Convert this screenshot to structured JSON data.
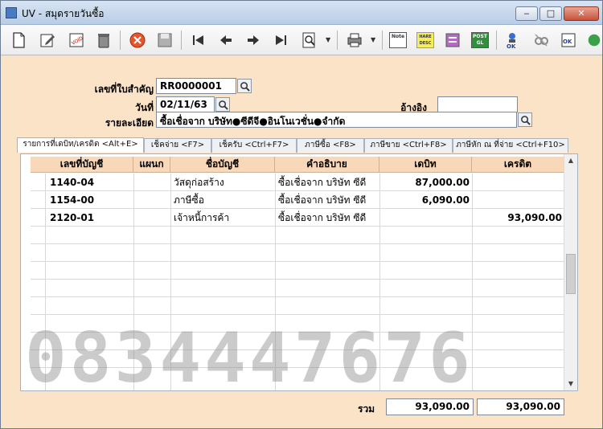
{
  "window": {
    "title": "UV - สมุดรายวันซื้อ",
    "buttons": {
      "minimize": "‒",
      "maximize": "□",
      "close": "✕"
    }
  },
  "toolbar": {
    "icons": [
      "new-document-icon",
      "edit-icon",
      "void-icon",
      "delete-icon",
      "cancel-icon",
      "save-icon",
      "first-record-icon",
      "previous-record-icon",
      "next-record-icon",
      "last-record-icon",
      "search-icon",
      "print-icon",
      "note-icon",
      "header-desc-icon",
      "edit-entry-icon",
      "post-gl-icon",
      "ok-icon",
      "unpost-icon",
      "approve-icon"
    ],
    "mini_labels": {
      "note": "Note",
      "header_desc": "HARE DESC",
      "post": "POST GL",
      "ok": "OK"
    }
  },
  "form": {
    "doc_no_label": "เลขที่ใบสำคัญ",
    "doc_no_value": "RR0000001",
    "date_label": "วันที่",
    "date_value": "02/11/63",
    "reference_label": "อ้างอิง",
    "reference_value": "",
    "description_label": "รายละเอียด",
    "description_value": "ซื้อเชื่อจาก  บริษัท●ซีดีจี●อินโนเวชั่น●จำกัด"
  },
  "tabs": [
    {
      "label": "รายการที่เดบิท/เครดิต <Alt+E>",
      "active": true
    },
    {
      "label": "เช็คจ่าย <F7>",
      "active": false
    },
    {
      "label": "เช็ครับ <Ctrl+F7>",
      "active": false
    },
    {
      "label": "ภาษีซื้อ <F8>",
      "active": false
    },
    {
      "label": "ภาษีขาย <Ctrl+F8>",
      "active": false
    },
    {
      "label": "ภาษีหัก ณ ที่จ่าย <Ctrl+F10>",
      "active": false
    }
  ],
  "grid": {
    "columns": [
      "เลขที่บัญชี",
      "แผนก",
      "ชื่อบัญชี",
      "คำอธิบาย",
      "เดบิท",
      "เครดิต"
    ],
    "rows": [
      {
        "account": "1140-04",
        "dept": "",
        "name": "วัสดุก่อสร้าง",
        "desc": "ซื้อเชื่อจาก  บริษัท ซีดี",
        "debit": "87,000.00",
        "credit": ""
      },
      {
        "account": "1154-00",
        "dept": "",
        "name": "ภาษีซื้อ",
        "desc": "ซื้อเชื่อจาก  บริษัท ซีดี",
        "debit": "6,090.00",
        "credit": ""
      },
      {
        "account": "2120-01",
        "dept": "",
        "name": "เจ้าหนี้การค้า",
        "desc": "ซื้อเชื่อจาก  บริษัท ซีดี",
        "debit": "",
        "credit": "93,090.00"
      }
    ]
  },
  "totals": {
    "label": "รวม",
    "debit": "93,090.00",
    "credit": "93,090.00"
  },
  "watermark": "0834447676"
}
